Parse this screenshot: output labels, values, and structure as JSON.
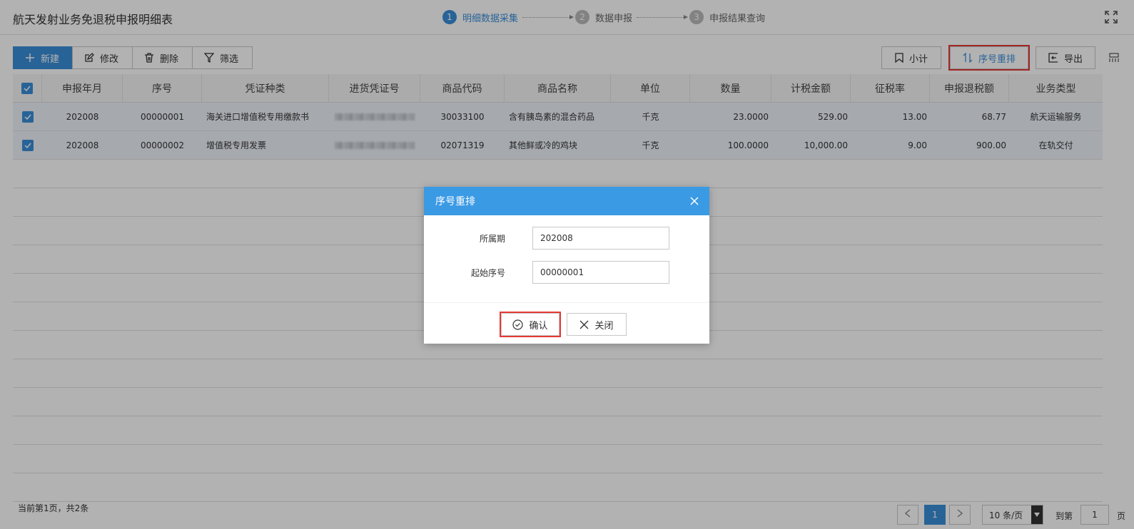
{
  "header": {
    "title": "航天发射业务免退税申报明细表",
    "steps": [
      {
        "num": "1",
        "label": "明细数据采集"
      },
      {
        "num": "2",
        "label": "数据申报"
      },
      {
        "num": "3",
        "label": "申报结果查询"
      }
    ]
  },
  "toolbar": {
    "new_label": "新建",
    "edit_label": "修改",
    "delete_label": "删除",
    "filter_label": "筛选",
    "subtotal_label": "小计",
    "reorder_label": "序号重排",
    "export_label": "导出"
  },
  "table": {
    "columns": [
      "申报年月",
      "序号",
      "凭证种类",
      "进货凭证号",
      "商品代码",
      "商品名称",
      "单位",
      "数量",
      "计税金额",
      "征税率",
      "申报退税额",
      "业务类型"
    ],
    "rows": [
      [
        "202008",
        "00000001",
        "海关进口增值税专用缴款书",
        "",
        "30033100",
        "含有胰岛素的混合药品",
        "千克",
        "23.0000",
        "529.00",
        "13.00",
        "68.77",
        "航天运输服务"
      ],
      [
        "202008",
        "00000002",
        "增值税专用发票",
        "",
        "02071319",
        "其他鲜或冷的鸡块",
        "千克",
        "100.0000",
        "10,000.00",
        "9.00",
        "900.00",
        "在轨交付"
      ]
    ]
  },
  "footer": {
    "summary": "当前第1页，共2条",
    "current_page": "1",
    "page_size": "10 条/页",
    "goto_label": "到第",
    "goto_value": "1",
    "page_unit": "页"
  },
  "modal": {
    "title": "序号重排",
    "period_label": "所属期",
    "period_value": "202008",
    "start_label": "起始序号",
    "start_value": "00000001",
    "confirm_label": "确认",
    "close_label": "关闭"
  },
  "colors": {
    "accent": "#3a8fd9",
    "modal_header": "#3b9ae4",
    "highlight": "#e53935"
  }
}
